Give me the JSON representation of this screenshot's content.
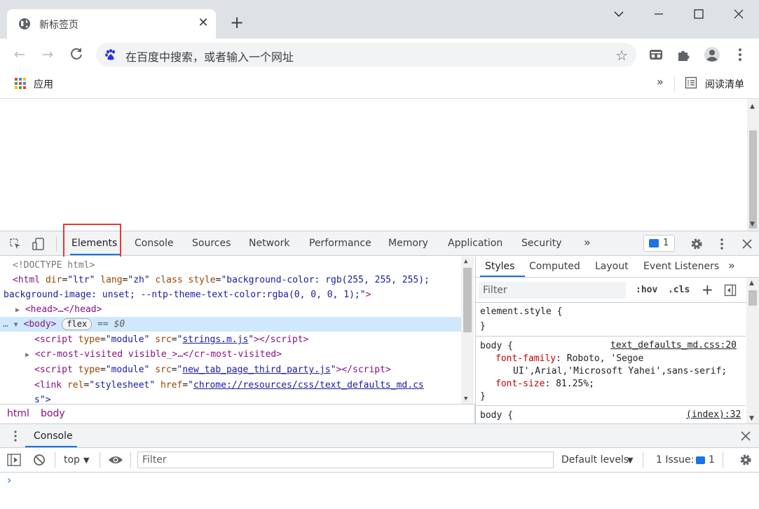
{
  "browser": {
    "tab_title": "新标签页",
    "omnibox_placeholder": "在百度中搜索，或者输入一个网址",
    "apps_label": "应用",
    "bookmarks_overflow": "»",
    "reading_list": "阅读清单"
  },
  "devtools": {
    "tabs": [
      "Elements",
      "Console",
      "Sources",
      "Network",
      "Performance",
      "Memory",
      "Application",
      "Security"
    ],
    "tabs_overflow": "»",
    "issues_count": "1",
    "dom": {
      "doctype": "<!DOCTYPE html>",
      "html_open_1a": "<html",
      "html_dir_attr": "dir",
      "html_dir_val": "\"ltr\"",
      "html_lang_attr": "lang",
      "html_lang_val": "\"zh\"",
      "html_class_attr": "class",
      "html_style_attr": "style",
      "html_style_val_1": "\"background-color: rgb(255, 255, 255);",
      "html_style_val_2": "background-image: unset; --ntp-theme-text-color:rgba(0, 0, 0, 1);\"",
      "html_close": ">",
      "head": "<head>…</head>",
      "body_open": "<body>",
      "flex_badge": "flex",
      "dollar_zero": "== $0",
      "script1_src": "strings.m.js",
      "cr_most_visited": "<cr-most-visited visible_>…</cr-most-visited>",
      "script2_src": "new_tab_page_third_party.js",
      "link_href_1": "chrome://resources/css/text_defaults_md.cs",
      "link_href_2": "s\">"
    },
    "breadcrumbs": [
      "html",
      "body"
    ],
    "styles_tabs": [
      "Styles",
      "Computed",
      "Layout",
      "Event Listeners"
    ],
    "styles_tabs_overflow": "»",
    "styles_filter_placeholder": "Filter",
    "hov": ":hov",
    "cls": ".cls",
    "rules": {
      "element_style": "element.style {",
      "close_brace": "}",
      "body_selector": "body {",
      "source1": "text_defaults_md.css:20",
      "font_family_prop": "font-family",
      "font_family_val_1": "Roboto, 'Segoe",
      "font_family_val_2": "UI',Arial,'Microsoft Yahei',sans-serif;",
      "font_size_prop": "font-size",
      "font_size_val": "81.25%;",
      "source2": "(index):32"
    },
    "drawer": {
      "tab": "Console",
      "context": "top",
      "filter_placeholder": "Filter",
      "levels": "Default levels",
      "issues_label": "1 Issue:",
      "issues_count": "1",
      "prompt": "›"
    }
  }
}
